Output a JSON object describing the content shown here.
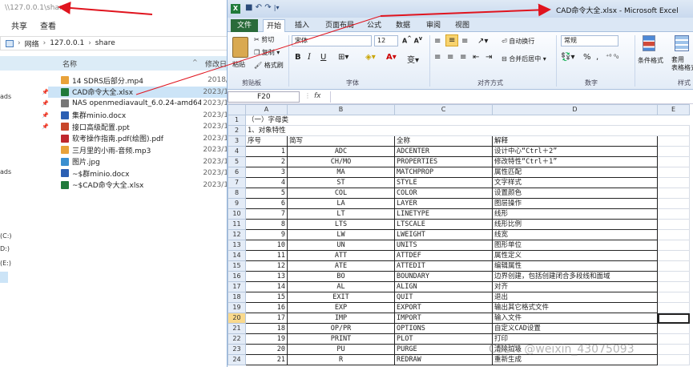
{
  "explorer": {
    "address_path": "\\\\127.0.0.1\\share",
    "ribbon": [
      "共享",
      "查看"
    ],
    "breadcrumb": [
      "网络",
      "127.0.0.1",
      "share"
    ],
    "columns": {
      "name": "名称",
      "date": "修改日"
    },
    "nav": [
      {
        "label": "ads"
      },
      {
        "label": "ads"
      },
      {
        "label": "(C:)"
      },
      {
        "label": "D:)"
      },
      {
        "label": "(E:)"
      }
    ],
    "files": [
      {
        "name": "14 SDRS后部分.mp4",
        "date": "2018/",
        "color": "#e8a23a",
        "pinned": false,
        "selected": false
      },
      {
        "name": "CAD命令大全.xlsx",
        "date": "2023/1",
        "color": "#1f7a3a",
        "pinned": true,
        "selected": true
      },
      {
        "name": "NAS openmediavault_6.0.24-amd64.iso",
        "date": "2023/1",
        "color": "#777777",
        "pinned": true,
        "selected": false
      },
      {
        "name": "集群minio.docx",
        "date": "2023/1",
        "color": "#2b5fb3",
        "pinned": true,
        "selected": false
      },
      {
        "name": "接口高级配置.ppt",
        "date": "2023/1",
        "color": "#c8462a",
        "pinned": true,
        "selected": false
      },
      {
        "name": "软考操作指南.pdf(绘图).pdf",
        "date": "2023/1",
        "color": "#c0272d",
        "pinned": false,
        "selected": false
      },
      {
        "name": "三月里的小雨-音频.mp3",
        "date": "2023/1",
        "color": "#e8a23a",
        "pinned": false,
        "selected": false
      },
      {
        "name": "图片.jpg",
        "date": "2023/1",
        "color": "#3a8fd0",
        "pinned": false,
        "selected": false
      },
      {
        "name": "~$群minio.docx",
        "date": "2023/1",
        "color": "#2b5fb3",
        "pinned": false,
        "selected": false
      },
      {
        "name": "~$CAD命令大全.xlsx",
        "date": "2023/1",
        "color": "#1f7a3a",
        "pinned": false,
        "selected": false
      }
    ]
  },
  "excel": {
    "window_title": "CAD命令大全.xlsx - Microsoft Excel",
    "tabs": [
      "文件",
      "开始",
      "插入",
      "页面布局",
      "公式",
      "数据",
      "审阅",
      "视图"
    ],
    "ribbon": {
      "paste": "粘贴",
      "cut": "剪切",
      "copy": "复制 ▾",
      "format_painter": "格式刷",
      "clipboard_group": "剪贴板",
      "font_name": "宋体",
      "font_size": "12",
      "font_group": "字体",
      "bold": "B",
      "italic": "I",
      "underline": "U",
      "wrap_text": "自动换行",
      "merge_center": "合并后居中 ▾",
      "alignment_group": "对齐方式",
      "number_format": "常规",
      "percent": "%",
      "comma": ",",
      "number_group": "数字",
      "conditional_format": "条件格式",
      "table_format": "套用\n表格格式",
      "styles_group": "样式"
    },
    "name_box": "F20",
    "fx": "fx",
    "columns": [
      "A",
      "B",
      "C",
      "D",
      "E"
    ],
    "row_numbers": [
      "1",
      "2",
      "3",
      "4",
      "5",
      "6",
      "7",
      "8",
      "9",
      "10",
      "11",
      "12",
      "13",
      "14",
      "15",
      "16",
      "17",
      "18",
      "19",
      "20",
      "21",
      "22",
      "23",
      "24"
    ],
    "active_row": "20",
    "row1": "（一）字母类",
    "row2": "1、对象特性",
    "header": [
      "序号",
      "简写",
      "全称",
      "解释"
    ],
    "commands": [
      [
        "1",
        "ADC",
        "ADCENTER",
        "设计中心“Ctrl＋2”"
      ],
      [
        "2",
        "CH/MO",
        "PROPERTIES",
        "修改特性“Ctrl＋1”"
      ],
      [
        "3",
        "MA",
        "MATCHPROP",
        "属性匹配"
      ],
      [
        "4",
        "ST",
        "STYLE",
        "文字样式"
      ],
      [
        "5",
        "COL",
        "COLOR",
        "设置颜色"
      ],
      [
        "6",
        "LA",
        "LAYER",
        "图层操作"
      ],
      [
        "7",
        "LT",
        "LINETYPE",
        "线形"
      ],
      [
        "8",
        "LTS",
        "LTSCALE",
        "线形比例"
      ],
      [
        "9",
        "LW",
        "LWEIGHT",
        "线宽"
      ],
      [
        "10",
        "UN",
        "UNITS",
        "图形单位"
      ],
      [
        "11",
        "ATT",
        "ATTDEF",
        "属性定义"
      ],
      [
        "12",
        "ATE",
        "ATTEDIT",
        "编辑属性"
      ],
      [
        "13",
        "BO",
        "BOUNDARY",
        "边界创建，包括创建闭合多段线和面域"
      ],
      [
        "14",
        "AL",
        "ALIGN",
        "对齐"
      ],
      [
        "15",
        "EXIT",
        "QUIT",
        "退出"
      ],
      [
        "16",
        "EXP",
        "EXPORT",
        "输出其它格式文件"
      ],
      [
        "17",
        "IMP",
        "IMPORT",
        "输入文件"
      ],
      [
        "18",
        "OP/PR",
        "OPTIONS",
        "自定义CAD设置"
      ],
      [
        "19",
        "PRINT",
        "PLOT",
        "打印"
      ],
      [
        "20",
        "PU",
        "PURGE",
        "清除垃圾"
      ],
      [
        "21",
        "R",
        "REDRAW",
        "重新生成"
      ]
    ]
  },
  "watermark": "CSDN @weixin_43075093",
  "colors": {
    "arrow": "#e0141e",
    "excel_green": "#1f7a3a",
    "ribbon_blue": "#dbe7f5",
    "selection": "#cce4f7"
  }
}
